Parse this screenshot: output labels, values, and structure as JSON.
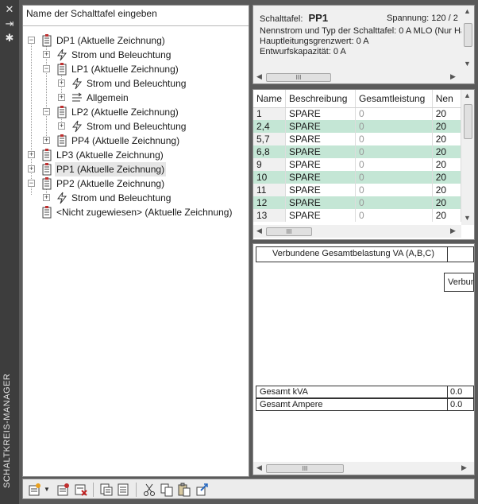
{
  "palette": {
    "title": "SCHALTKREIS-MANAGER"
  },
  "search": {
    "placeholder": "Name der Schalttafel eingeben"
  },
  "tree": {
    "nodes": [
      {
        "label": "DP1 (Aktuelle Zeichnung)",
        "icon": "panel-icon"
      },
      {
        "label": "Strom und Beleuchtung",
        "icon": "lightning-icon"
      },
      {
        "label": "LP1 (Aktuelle Zeichnung)",
        "icon": "panel-icon"
      },
      {
        "label": "Strom und Beleuchtung",
        "icon": "lightning-icon"
      },
      {
        "label": "Allgemein",
        "icon": "general-circuit-icon"
      },
      {
        "label": "LP2 (Aktuelle Zeichnung)",
        "icon": "panel-icon"
      },
      {
        "label": "Strom und Beleuchtung",
        "icon": "lightning-icon"
      },
      {
        "label": "PP4 (Aktuelle Zeichnung)",
        "icon": "panel-icon"
      },
      {
        "label": "LP3 (Aktuelle Zeichnung)",
        "icon": "panel-icon"
      },
      {
        "label": "PP1 (Aktuelle Zeichnung)",
        "icon": "panel-icon"
      },
      {
        "label": "PP2 (Aktuelle Zeichnung)",
        "icon": "panel-icon"
      },
      {
        "label": "Strom und Beleuchtung",
        "icon": "lightning-icon"
      },
      {
        "label": "<Nicht zugewiesen> (Aktuelle Zeichnung)",
        "icon": "panel-icon"
      }
    ]
  },
  "info": {
    "panel_label": "Schalttafel:",
    "panel_value": "PP1",
    "voltage": "Spannung: 120 / 2",
    "rating": "Nennstrom und Typ der Schalttafel: 0 A MLO (Nur Ha",
    "main_limit": "Hauptleitungsgrenzwert: 0 A",
    "design_capacity": "Entwurfskapazität: 0 A"
  },
  "circuits": {
    "columns": [
      "Name",
      "Beschreibung",
      "Gesamtleistung",
      "Nen"
    ],
    "rows": [
      {
        "name": "1",
        "desc": "SPARE",
        "load": "0",
        "rated": "20"
      },
      {
        "name": "2,4",
        "desc": "SPARE",
        "load": "0",
        "rated": "20"
      },
      {
        "name": "5,7",
        "desc": "SPARE",
        "load": "0",
        "rated": "20"
      },
      {
        "name": "6,8",
        "desc": "SPARE",
        "load": "0",
        "rated": "20"
      },
      {
        "name": "9",
        "desc": "SPARE",
        "load": "0",
        "rated": "20"
      },
      {
        "name": "10",
        "desc": "SPARE",
        "load": "0",
        "rated": "20"
      },
      {
        "name": "11",
        "desc": "SPARE",
        "load": "0",
        "rated": "20"
      },
      {
        "name": "12",
        "desc": "SPARE",
        "load": "0",
        "rated": "20"
      },
      {
        "name": "13",
        "desc": "SPARE",
        "load": "0",
        "rated": "20"
      }
    ]
  },
  "load": {
    "header": "Verbundene Gesamtbelastung VA (A,B,C)",
    "sub_header": "Verbun",
    "total_kva_label": "Gesamt kVA",
    "total_kva_value": "0.0",
    "total_amps_label": "Gesamt Ampere",
    "total_amps_value": "0.0"
  },
  "colors": {
    "alt_row": "#c4e6d5",
    "strip": "#3d3d3d"
  }
}
